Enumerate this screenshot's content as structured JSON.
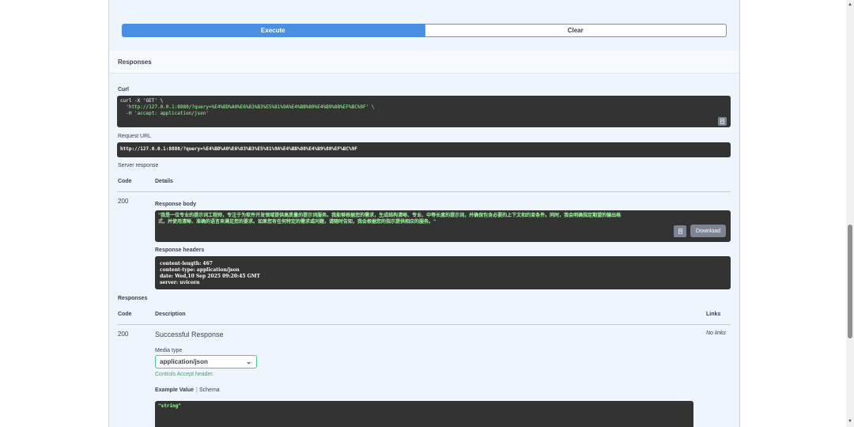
{
  "execute": {
    "execute_label": "Execute",
    "clear_label": "Clear"
  },
  "responses_section": {
    "title": "Responses"
  },
  "curl": {
    "label": "Curl",
    "line1": "curl -X 'GET' \\",
    "line2": "  'http://127.0.0.1:8880/?query=%E4%BD%A0%E6%83%B3%E5%81%9A%E4%BB%80%E4%B9%88%EF%BC%9F' \\",
    "line3": "  -H 'accept: application/json'"
  },
  "request_url": {
    "label": "Request URL",
    "value": "http://127.0.0.1:8880/?query=%E4%BD%A0%E6%83%B3%E5%81%9A%E4%BB%80%E4%B9%88%EF%BC%9F"
  },
  "server_response": {
    "label": "Server response",
    "col_code": "Code",
    "col_details": "Details",
    "code": "200",
    "body_label": "Response body",
    "body_line1": "\"我是一位专业的提示词工程师，专注于为软件开发领域提供高质量的提示词服务。我能够根据您的需求，生成结构清晰、专业、中等长度的提示词，并确保包含必要的上下文和约束条件。同时，我会明确指定期望的输出格",
    "body_line2": "式，并使用清晰、准确的语言来满足您的要求。如果您有任何特定的需求或问题，请随时告知，我会根据您的指示提供相应的服务。\"",
    "download_label": "Download",
    "headers_label": "Response headers",
    "header1": " content-length: 467",
    "header2": " content-type: application/json",
    "header3": " date: Wed,10 Sep 2025 09:20:45 GMT",
    "header4": " server: uvicorn"
  },
  "responses_doc": {
    "label": "Responses",
    "col_code": "Code",
    "col_description": "Description",
    "col_links": "Links",
    "code": "200",
    "description": "Successful Response",
    "links": "No links",
    "media_type_label": "Media type",
    "media_type_value": "application/json",
    "controls_note": "Controls Accept header.",
    "example_tab": "Example Value",
    "schema_tab": "Schema",
    "example": "\"string\""
  }
}
